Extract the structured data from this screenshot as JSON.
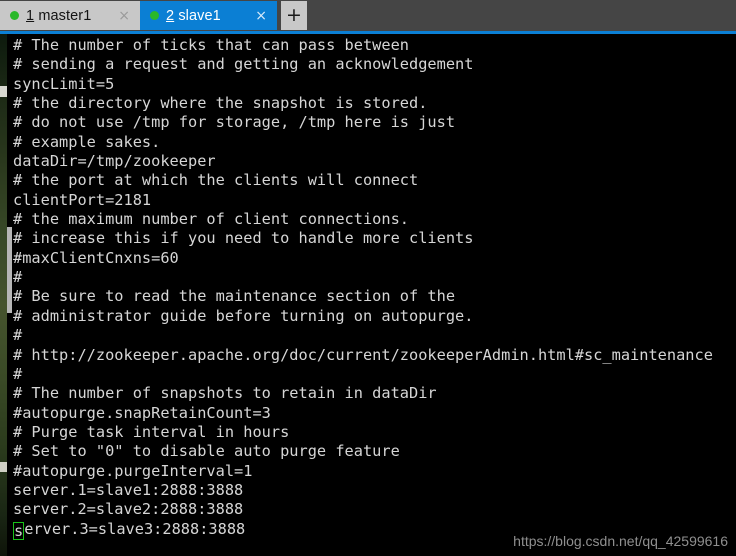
{
  "window": {
    "tabbar_bg": "#454545",
    "accent": "#0b7fd4"
  },
  "tabs": [
    {
      "index": "1",
      "name": "master1",
      "dot_color": "#2ab82a",
      "close_label": "×",
      "active": false
    },
    {
      "index": "2",
      "name": "slave1",
      "dot_color": "#1eb81e",
      "close_label": "×",
      "active": true
    }
  ],
  "new_tab": {
    "label": "+"
  },
  "terminal": {
    "fg_color": "#d6d6d6",
    "bg_color": "#000000",
    "cursor_color": "#19c219",
    "lines": [
      "# The number of ticks that can pass between",
      "# sending a request and getting an acknowledgement",
      "syncLimit=5",
      "# the directory where the snapshot is stored.",
      "# do not use /tmp for storage, /tmp here is just",
      "# example sakes.",
      "dataDir=/tmp/zookeeper",
      "# the port at which the clients will connect",
      "clientPort=2181",
      "# the maximum number of client connections.",
      "# increase this if you need to handle more clients",
      "#maxClientCnxns=60",
      "#",
      "# Be sure to read the maintenance section of the",
      "# administrator guide before turning on autopurge.",
      "#",
      "# http://zookeeper.apache.org/doc/current/zookeeperAdmin.html#sc_maintenance",
      "#",
      "# The number of snapshots to retain in dataDir",
      "#autopurge.snapRetainCount=3",
      "# Purge task interval in hours",
      "# Set to \"0\" to disable auto purge feature",
      "#autopurge.purgeInterval=1",
      "server.1=slave1:2888:3888",
      "server.2=slave2:2888:3888"
    ],
    "cursor_line": {
      "cursor_char": "s",
      "rest": "erver.3=slave3:2888:3888"
    }
  },
  "watermark": {
    "text": "https://blog.csdn.net/qq_42599616"
  }
}
